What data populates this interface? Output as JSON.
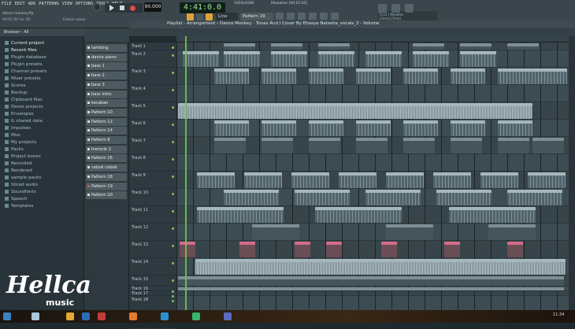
{
  "menu": [
    "FILE",
    "EDIT",
    "ADD",
    "PATTERNS",
    "VIEW",
    "OPTIONS",
    "TOOLS",
    "HELP"
  ],
  "song": {
    "name": "dance monkey.flp",
    "time": "49:01:00 for 3D",
    "artist": "Eebuk sebuk"
  },
  "tempo": "90.000",
  "time_display": "4:41:0.0",
  "cpu": "1920x1080",
  "memory": "Mewalian [00:05:05]",
  "line_label": "Line",
  "pattern_label": "Pattern 19",
  "news": [
    "FL12 | Moodles",
    "Library [Free]"
  ],
  "playlist_title": "Playlist - Arrangement › Dance Monkey - Tones And I Cover By Ehasya Natasha_vocals_3 - Volume",
  "browser": {
    "header": "Browser - All",
    "items": [
      "Current project",
      "Recent files",
      "Plugin database",
      "Plugin presets",
      "Channel presets",
      "Mixer presets",
      "Scores",
      "Backup",
      "Clipboard files",
      "Demo projects",
      "Envelopes",
      "IL shared data",
      "Impulses",
      "Misc",
      "My projects",
      "Packs",
      "Project bones",
      "Recorded",
      "Rendered",
      "sample packs",
      "Sliced audio",
      "Soundfonts",
      "Speech",
      "Templates"
    ]
  },
  "picker": [
    "tambing",
    "dance piano",
    "bass 1",
    "bass 2",
    "bass 3",
    "bass intro",
    "kecakan",
    "Pattern 10",
    "Pattern 12",
    "Pattern 14",
    "Pattern 8",
    "tremolo 2",
    "Pattern 16",
    "cebok cebok",
    "Pattern 18",
    "Pattern 19",
    "Pattern 20"
  ],
  "tracks": [
    "Track 1",
    "Track 2",
    "Track 3",
    "Track 4",
    "Track 5",
    "Track 6",
    "Track 7",
    "Track 8",
    "Track 9",
    "Track 10",
    "Track 11",
    "Track 12",
    "Track 13",
    "Track 14",
    "Track 15",
    "Track 16",
    "Track 17",
    "Track 18",
    "Track 19"
  ],
  "clip_labels": {
    "tambing": "tambing",
    "piano": "dan_pia",
    "patt": "Patt. 19",
    "vocal": "Dance Monkey - Tones And I Cover By Ehasya Natasha_vocals_3 - Volume",
    "vocal_guitar": "acous guitar",
    "bass": "bass 2",
    "kec": "kecakan",
    "p20": "Pattern 20",
    "p16": "Pattern 16",
    "p14": "Pattern 14",
    "p10": "Pattern 10",
    "vol": "Dance Monkey - Tones And I Cover By Ehasya Natasha_vocals_3"
  },
  "taskbar_clock": "11:34",
  "brand": "Hellcat music",
  "colors": {
    "accent": "#6fc64a",
    "record": "#e24b4b",
    "highlight": "#e0a13b"
  }
}
